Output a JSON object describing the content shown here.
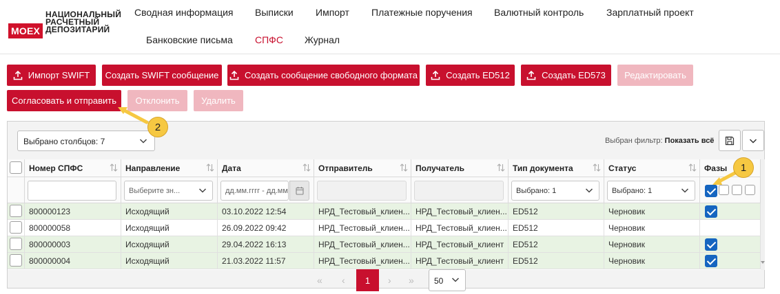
{
  "logo": {
    "badge": "MOEX",
    "lines": [
      "НАЦИОНАЛЬНЫЙ",
      "РАСЧЕТНЫЙ",
      "ДЕПОЗИТАРИЙ"
    ]
  },
  "nav": {
    "items": [
      "Сводная информация",
      "Выписки",
      "Импорт",
      "Платежные поручения",
      "Валютный контроль",
      "Зарплатный проект",
      "Банковские письма",
      "СПФС",
      "Журнал"
    ],
    "active": "СПФС"
  },
  "toolbar": {
    "import_swift": "Импорт SWIFT",
    "create_swift": "Создать SWIFT сообщение",
    "create_free": "Создать сообщение свободного формата",
    "create_ed512": "Создать ED512",
    "create_ed573": "Создать ED573",
    "edit": "Редактировать",
    "approve_send": "Согласовать и отправить",
    "reject": "Отклонить",
    "delete": "Удалить"
  },
  "table_controls": {
    "columns_selected": "Выбрано столбцов: 7",
    "filter_label": "Выбран фильтр:",
    "filter_value": "Показать всё"
  },
  "table": {
    "headers": [
      "Номер СПФС",
      "Направление",
      "Дата",
      "Отправитель",
      "Получатель",
      "Тип документа",
      "Статус",
      "Фазы"
    ],
    "filters": {
      "direction_placeholder": "Выберите зн...",
      "date_placeholder": "дд.мм.гггг - дд.мм",
      "doc_type": "Выбрано: 1",
      "status": "Выбрано: 1"
    },
    "rows": [
      {
        "number": "800000123",
        "direction": "Исходящий",
        "date": "03.10.2022 12:54",
        "sender": "НРД_Тестовый_клиен...",
        "receiver": "НРД_Тестовый_клиен...",
        "type": "ED512",
        "status": "Черновик",
        "phase": true,
        "highlight": true
      },
      {
        "number": "800000058",
        "direction": "Исходящий",
        "date": "26.09.2022 09:42",
        "sender": "НРД_Тестовый_клиен...",
        "receiver": "НРД_Тестовый_клиен...",
        "type": "ED512",
        "status": "Черновик",
        "phase": false,
        "highlight": false
      },
      {
        "number": "800000003",
        "direction": "Исходящий",
        "date": "29.04.2022 16:13",
        "sender": "НРД_Тестовый_клиен...",
        "receiver": "НРД_Тестовый_клиент",
        "type": "ED512",
        "status": "Черновик",
        "phase": true,
        "highlight": true
      },
      {
        "number": "800000004",
        "direction": "Исходящий",
        "date": "21.03.2022 11:57",
        "sender": "НРД_Тестовый_клиен...",
        "receiver": "НРД_Тестовый_клиент",
        "type": "ED512",
        "status": "Черновик",
        "phase": true,
        "highlight": true
      }
    ]
  },
  "pagination": {
    "first": "«",
    "prev": "‹",
    "current": "1",
    "next": "›",
    "last": "»",
    "page_size": "50"
  },
  "markers": [
    "1",
    "2"
  ],
  "colors": {
    "brand": "#c8102e",
    "disabled": "#f0b7bf",
    "row_highlight": "#e8f3e3",
    "check": "#1565c0",
    "marker": "#f6c842"
  }
}
